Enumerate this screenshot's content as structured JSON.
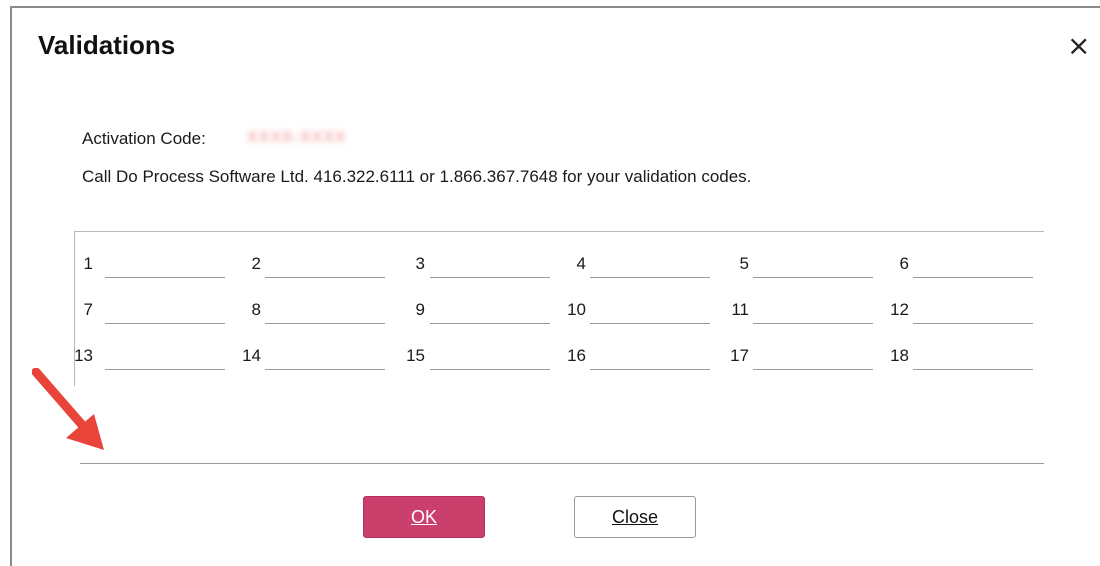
{
  "dialog": {
    "title": "Validations",
    "close_icon": "×"
  },
  "activation": {
    "label": "Activation Code:",
    "value": "XXXX-XXXX"
  },
  "instructions": "Call Do Process Software Ltd. 416.322.6111 or 1.866.367.7648 for your validation codes.",
  "validation_fields": {
    "labels": [
      "1",
      "2",
      "3",
      "4",
      "5",
      "6",
      "7",
      "8",
      "9",
      "10",
      "11",
      "12",
      "13",
      "14",
      "15",
      "16",
      "17",
      "18"
    ],
    "values": [
      "",
      "",
      "",
      "",
      "",
      "",
      "",
      "",
      "",
      "",
      "",
      "",
      "",
      "",
      "",
      "",
      "",
      ""
    ]
  },
  "message_field": {
    "value": ""
  },
  "buttons": {
    "ok": "OK",
    "close": "Close"
  },
  "colors": {
    "primary_button": "#cb3f6c",
    "annotation_arrow": "#e8443a"
  }
}
